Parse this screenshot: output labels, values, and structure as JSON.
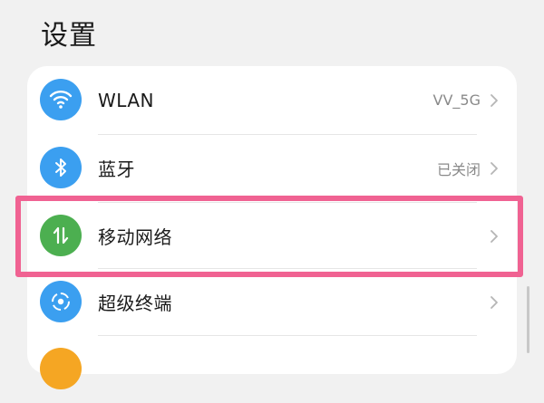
{
  "header": {
    "title": "设置"
  },
  "items": [
    {
      "label": "WLAN",
      "value": "VV_5G",
      "icon": "wifi-icon",
      "color": "#3b9ff0"
    },
    {
      "label": "蓝牙",
      "value": "已关闭",
      "icon": "bluetooth-icon",
      "color": "#3b9ff0"
    },
    {
      "label": "移动网络",
      "value": "",
      "icon": "mobile-network-icon",
      "color": "#4caf50"
    },
    {
      "label": "超级终端",
      "value": "",
      "icon": "super-device-icon",
      "color": "#3b9ff0"
    },
    {
      "label": "",
      "value": "",
      "icon": "partial-icon",
      "color": "#f5a623"
    }
  ],
  "highlight": {
    "color": "#f06292"
  }
}
